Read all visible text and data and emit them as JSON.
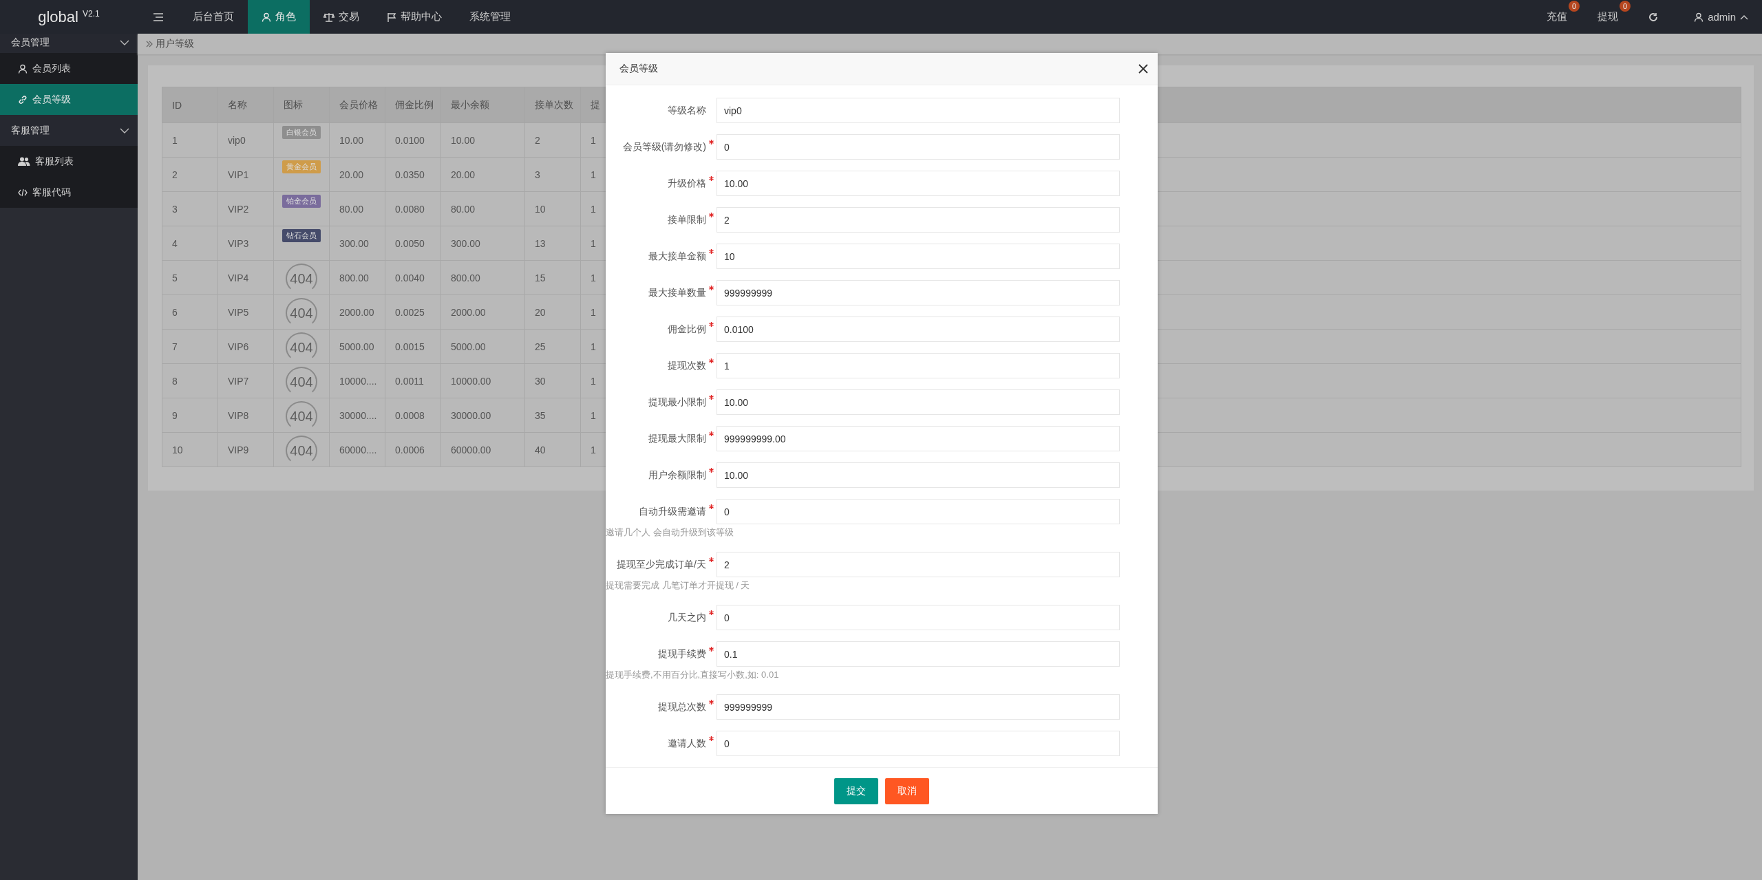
{
  "logo": "global $^{V2.1}$",
  "top_nav": [
    {
      "label": "后台首页",
      "selected": false
    },
    {
      "label": "角色",
      "selected": true
    },
    {
      "label": "交易",
      "selected": false
    },
    {
      "label": "帮助中心",
      "selected": false
    },
    {
      "label": "系统管理",
      "selected": false
    }
  ],
  "top_right": [
    {
      "label": "充值",
      "badge": "0"
    },
    {
      "label": "提现",
      "badge": "0"
    }
  ],
  "user": "admin",
  "sidebar": [
    {
      "label": "会员管理",
      "expanded": true,
      "children": [
        {
          "label": "会员列表",
          "selected": false
        },
        {
          "label": "会员等级",
          "selected": true
        }
      ]
    },
    {
      "label": "客服管理",
      "expanded": true,
      "children": [
        {
          "label": "客服列表",
          "selected": false
        },
        {
          "label": "客服代码",
          "selected": false
        }
      ]
    }
  ],
  "breadcrumb": "用户等级",
  "table": {
    "columns": [
      "ID",
      "名称",
      "图标",
      "会员价格",
      "佣金比例",
      "最小余额",
      "接单次数",
      "提"
    ],
    "rows": [
      {
        "id": "1",
        "name": "vip0",
        "icon": {
          "kind": "badge",
          "text": "白银会员",
          "color": "#8e8e8e"
        },
        "price": "10.00",
        "commission": "0.0100",
        "min_balance": "10.00",
        "orders": "2",
        "column_8": "1"
      },
      {
        "id": "2",
        "name": "VIP1",
        "icon": {
          "kind": "badge",
          "text": "黄金会员",
          "color": "#cf9c4a"
        },
        "price": "20.00",
        "commission": "0.0350",
        "min_balance": "20.00",
        "orders": "3",
        "column_8": "1"
      },
      {
        "id": "3",
        "name": "VIP2",
        "icon": {
          "kind": "badge",
          "text": "铂金会员",
          "color": "#7a6c9c"
        },
        "price": "80.00",
        "commission": "0.0080",
        "min_balance": "80.00",
        "orders": "10",
        "column_8": "1"
      },
      {
        "id": "4",
        "name": "VIP3",
        "icon": {
          "kind": "badge",
          "text": "钻石会员",
          "color": "#454b6a"
        },
        "price": "300.00",
        "commission": "0.0050",
        "min_balance": "300.00",
        "orders": "13",
        "column_8": "1"
      },
      {
        "id": "5",
        "name": "VIP4",
        "icon": {
          "kind": "broken",
          "text": "404"
        },
        "price": "800.00",
        "commission": "0.0040",
        "min_balance": "800.00",
        "orders": "15",
        "column_8": "1"
      },
      {
        "id": "6",
        "name": "VIP5",
        "icon": {
          "kind": "broken",
          "text": "404"
        },
        "price": "2000.00",
        "commission": "0.0025",
        "min_balance": "2000.00",
        "orders": "20",
        "column_8": "1"
      },
      {
        "id": "7",
        "name": "VIP6",
        "icon": {
          "kind": "broken",
          "text": "404"
        },
        "price": "5000.00",
        "commission": "0.0015",
        "min_balance": "5000.00",
        "orders": "25",
        "column_8": "1"
      },
      {
        "id": "8",
        "name": "VIP7",
        "icon": {
          "kind": "broken",
          "text": "404"
        },
        "price": "10000....",
        "commission": "0.0011",
        "min_balance": "10000.00",
        "orders": "30",
        "column_8": "1"
      },
      {
        "id": "9",
        "name": "VIP8",
        "icon": {
          "kind": "broken",
          "text": "404"
        },
        "price": "30000....",
        "commission": "0.0008",
        "min_balance": "30000.00",
        "orders": "35",
        "column_8": "1"
      },
      {
        "id": "10",
        "name": "VIP9",
        "icon": {
          "kind": "broken",
          "text": "404"
        },
        "price": "60000....",
        "commission": "0.0006",
        "min_balance": "60000.00",
        "orders": "40",
        "column_8": "1"
      }
    ]
  },
  "modal": {
    "title": "会员等级",
    "fields": [
      {
        "label": "等级名称",
        "required": false,
        "value": "vip0"
      },
      {
        "label": "会员等级(请勿修改)",
        "required": true,
        "value": "0"
      },
      {
        "label": "升级价格",
        "required": true,
        "value": "10.00"
      },
      {
        "label": "接单限制",
        "required": true,
        "value": "2"
      },
      {
        "label": "最大接单金额",
        "required": true,
        "value": "10"
      },
      {
        "label": "最大接单数量",
        "required": true,
        "value": "999999999"
      },
      {
        "label": "佣金比例",
        "required": true,
        "value": "0.0100"
      },
      {
        "label": "提现次数",
        "required": true,
        "value": "1"
      },
      {
        "label": "提现最小限制",
        "required": true,
        "value": "10.00"
      },
      {
        "label": "提现最大限制",
        "required": true,
        "value": "999999999.00"
      },
      {
        "label": "用户余额限制",
        "required": true,
        "value": "10.00"
      },
      {
        "label": "自动升级需邀请",
        "required": true,
        "value": "0",
        "hint": "邀请几个人 会自动升级到该等级"
      },
      {
        "label": "提现至少完成订单/天",
        "required": true,
        "value": "2",
        "hint": "提现需要完成 几笔订单才开提现 / 天"
      },
      {
        "label": "几天之内",
        "required": true,
        "value": "0"
      },
      {
        "label": "提现手续费",
        "required": true,
        "value": "0.1",
        "hint": "提现手续费,不用百分比,直接写小数,如: 0.01"
      },
      {
        "label": "提现总次数",
        "required": true,
        "value": "999999999"
      },
      {
        "label": "邀请人数",
        "required": true,
        "value": "0"
      }
    ],
    "buttons": [
      {
        "label": "提交",
        "kind": "primary"
      },
      {
        "label": "取消",
        "kind": "cancel"
      }
    ]
  }
}
